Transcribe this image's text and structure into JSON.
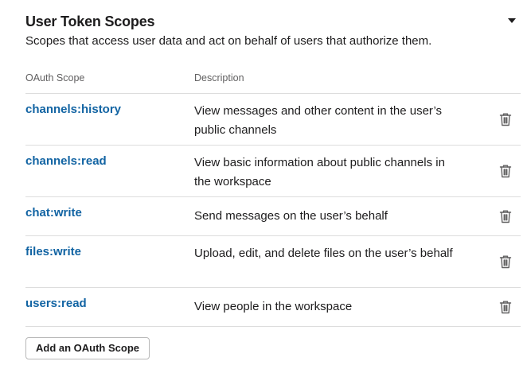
{
  "section": {
    "title": "User Token Scopes",
    "description": "Scopes that access user data and act on behalf of users that authorize them.",
    "toggle_icon": "caret-down-icon"
  },
  "table": {
    "headers": {
      "scope": "OAuth Scope",
      "description": "Description"
    },
    "rows": [
      {
        "scope": "channels:history",
        "description": "View messages and other content in the user’s public channels",
        "action_icon": "trash-icon"
      },
      {
        "scope": "channels:read",
        "description": "View basic information about public channels in the workspace",
        "action_icon": "trash-icon"
      },
      {
        "scope": "chat:write",
        "description": "Send messages on the user’s behalf",
        "action_icon": "trash-icon"
      },
      {
        "scope": "files:write",
        "description": "Upload, edit, and delete files on the user’s behalf",
        "action_icon": "trash-icon"
      },
      {
        "scope": "users:read",
        "description": "View people in the workspace",
        "action_icon": "trash-icon"
      }
    ]
  },
  "actions": {
    "add_scope_label": "Add an OAuth Scope"
  },
  "colors": {
    "link": "#1264a3",
    "text": "#1d1c1d",
    "muted": "#616061",
    "divider": "#dddddd",
    "icon": "#616061"
  }
}
